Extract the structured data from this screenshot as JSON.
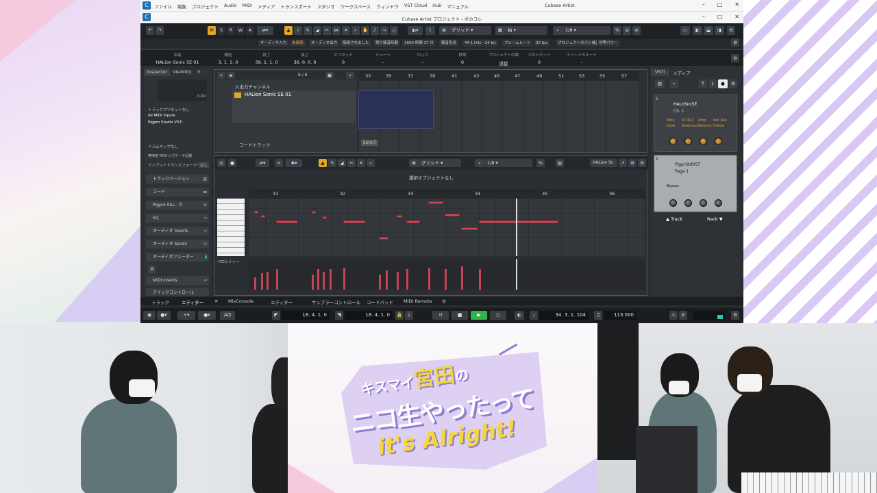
{
  "window": {
    "os_menu": [
      "ファイル",
      "編集",
      "プロジェクト",
      "Audio",
      "MIDI",
      "メディア",
      "トランスポート",
      "スタジオ",
      "ワークスペース",
      "ウィンドウ",
      "VST Cloud",
      "Hub",
      "マニュアル"
    ],
    "app_title": "Cubase Artist",
    "project_title": "Cubase Artist プロジェクト - ボカコレ"
  },
  "toolbar": {
    "mute_solo": [
      "M",
      "S",
      "R",
      "W",
      "A"
    ],
    "grid_label": "グリッド",
    "grid_mode": "拍",
    "quantize": "1/8"
  },
  "infobar": [
    "オーディオ入力",
    "未接続",
    "オーディオ出力",
    "接続されました",
    "残り録音時間",
    "1609 時間 37 分",
    "録音形式",
    "44.1 kHz - 24 bit",
    "フレームレート",
    "30 fps",
    "プロジェクトのパン補正",
    "均等パワー"
  ],
  "position": {
    "name_label": "名前",
    "name": "HALion Sonic SE 01",
    "start_label": "開始",
    "start": "3. 1. 1. 0",
    "end_label": "終了",
    "end": "39. 1. 1. 0",
    "length_label": "長さ",
    "length": "36. 0. 0. 0",
    "offset_label": "オフセット",
    "offset": "0",
    "mute_label": "ミュート",
    "mute": "-",
    "lock_label": "ロック",
    "lock": "-",
    "transpose_label": "移調",
    "transpose": "0",
    "proj_transpose_label": "プロジェクトの調",
    "proj_transpose": "追従",
    "velocity_label": "ベロシティー",
    "velocity": "0",
    "event_root_label": "イベントのルート",
    "event_root": "-"
  },
  "inspector": {
    "tab1": "Inspector",
    "tab2": "Visibility",
    "volume": "0.00",
    "routing": [
      "トラックプリセットなし",
      "All MIDI Inputs",
      "Pigpro Studio VSTi"
    ],
    "drum_map": "ドラムマップなし",
    "midi_input_label": "無接続 MIDI 入力データ記録",
    "input_transform": "インプットトランスフォーマー",
    "input_transform_value": "なし",
    "sections": [
      "トラックバージョン",
      "コード",
      "Pigpro Stu... Ti",
      "EQ",
      "オーディオ Inserts",
      "オーディオ Sends",
      "オーディオフェーダー",
      "MIDI Inserts",
      "クイックコントロール"
    ]
  },
  "arrange": {
    "counter": "6 / 6",
    "folder": "入出力チャンネル",
    "track_name": "HALion Sonic SE 01",
    "chord_track": "コードトラック",
    "chord_event": "Emin7",
    "bars": [
      "33",
      "35",
      "37",
      "39",
      "41",
      "43",
      "45",
      "47",
      "49",
      "51",
      "53",
      "55",
      "57"
    ]
  },
  "editor": {
    "grid_label": "グリッド",
    "quantize": "1/8",
    "instrument": "HALion Sc",
    "message": "選択オブジェクトなし",
    "bars": [
      "31",
      "32",
      "33",
      "34",
      "35",
      "36"
    ],
    "velocity_label": "ベロシティー"
  },
  "vsti": {
    "tab1": "VSTi",
    "tab2": "メディア",
    "slot1_index": "1",
    "slot1_name": "HALnSncSE",
    "slot1_sub": "Ch. 1",
    "slot1_params": [
      "Tone",
      "Sf QC2",
      "Amp",
      "Pan Key",
      "Color",
      "Simpheck",
      "Velocity",
      "Follow"
    ],
    "slot2_index": "2",
    "slot2_name": "PigprStdVST",
    "slot2_sub": "Page 1",
    "slot2_bypass": "Bypass",
    "track_btn": "Track",
    "rack_btn": "Rack"
  },
  "bottom_tabs": [
    "トラック",
    "エディター",
    "MixConsole",
    "エディター",
    "サンプラーコントロール",
    "コードパッド",
    "MIDI Remote"
  ],
  "transport": {
    "aq": "AQ",
    "left_locator": "18. 4. 1. 0",
    "right_locator": "18. 4. 1. 0",
    "position": "34. 3. 1. 104",
    "tempo": "113.000"
  },
  "overlay": {
    "line1a": "キスマイ",
    "line1b": "宮田",
    "line1c": "の",
    "line2": "ニコ生やったって",
    "line3": "it's Alright!"
  },
  "colors": {
    "accent": "#e0a52a",
    "note": "#d24a5a",
    "play": "#2fb34a",
    "banner": "#ddd0f3"
  }
}
